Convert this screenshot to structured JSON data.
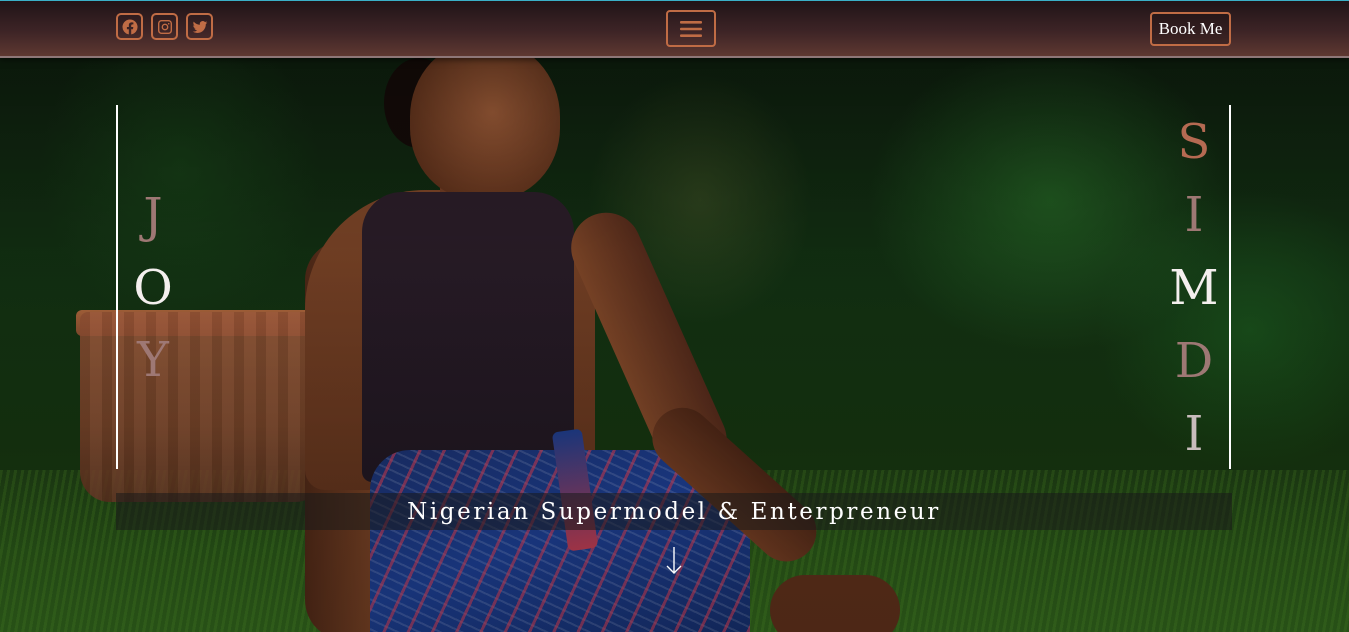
{
  "navbar": {
    "social_icons": [
      "facebook-icon",
      "instagram-icon",
      "twitter-icon"
    ],
    "menu_icon": "hamburger-menu-icon",
    "book_label": "Book Me"
  },
  "hero": {
    "name_left_letters": [
      "J",
      "O",
      "Y"
    ],
    "name_right_letters": [
      "S",
      "I",
      "M",
      "D",
      "I"
    ],
    "tagline": "Nigerian Supermodel & Enterpreneur",
    "scroll_icon": "arrow-down-icon"
  },
  "colors": {
    "accent": "#c06c45",
    "navbar_top": "#201417",
    "navbar_bottom": "#5e3831",
    "text": "#ffffff"
  }
}
